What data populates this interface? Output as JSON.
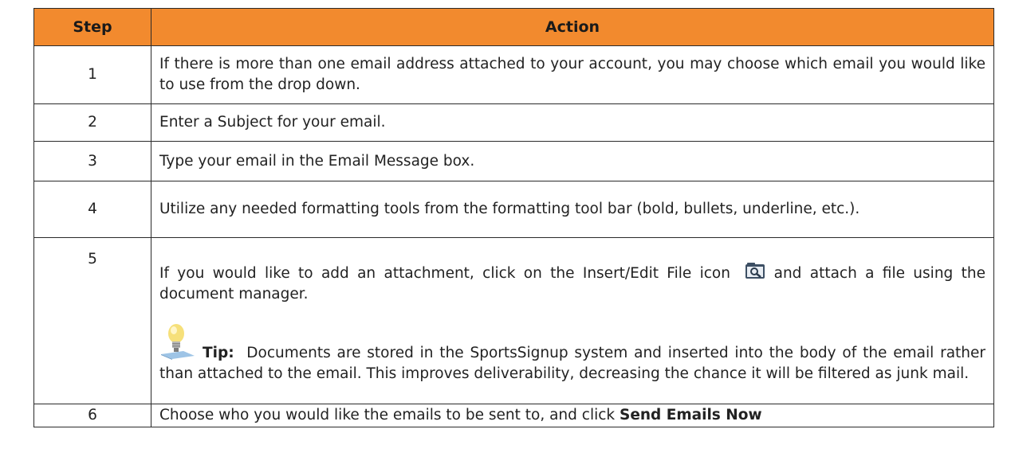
{
  "table": {
    "headers": {
      "step": "Step",
      "action": "Action"
    },
    "rows": [
      {
        "step": "1",
        "action": "If there is more than one email address attached to your account, you may choose which email you would like to use from the drop down."
      },
      {
        "step": "2",
        "action": "Enter a Subject for your email."
      },
      {
        "step": "3",
        "action": "Type your email in the Email Message box."
      },
      {
        "step": "4",
        "action": "Utilize any needed formatting tools from the formatting tool bar (bold, bullets, underline, etc.)."
      },
      {
        "step": "5",
        "action_part1": "If you would like to add an attachment, click on the Insert/Edit File icon",
        "action_part2": "and attach a file using the document manager.",
        "tip_label": "Tip:",
        "tip_text": "Documents are stored in the SportsSignup system and inserted into the body of the email rather than attached to the email. This improves deliverability, decreasing the chance it will be filtered as junk mail."
      },
      {
        "step": "6",
        "action_part1": "Choose who you would like the emails to be sent to, and click ",
        "action_bold": "Send Emails Now"
      }
    ]
  },
  "colors": {
    "header_bg": "#f28a2e",
    "border": "#2a2a2a",
    "text": "#222222"
  },
  "icons": {
    "file_icon": "insert-edit-file-icon",
    "tip_icon": "lightbulb-icon"
  }
}
